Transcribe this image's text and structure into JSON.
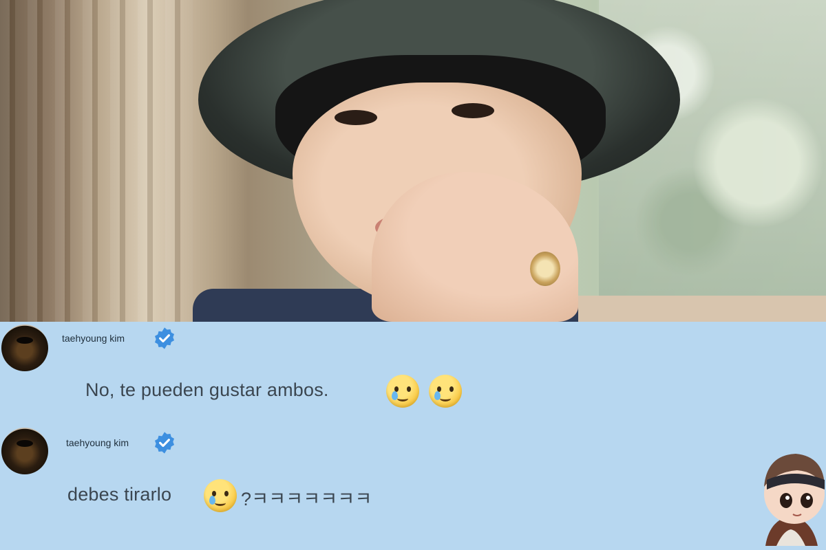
{
  "comments": [
    {
      "username": "taehyoung kim",
      "verified": true,
      "text": "No, te pueden gustar ambos.",
      "emojis": [
        "smiling-face-with-tear",
        "smiling-face-with-tear"
      ],
      "suffix": ""
    },
    {
      "username": "taehyoung kim",
      "verified": true,
      "text": "debes tirarlo",
      "emojis": [
        "smiling-face-with-tear"
      ],
      "suffix": "?ㅋㅋㅋㅋㅋㅋㅋ"
    }
  ],
  "colors": {
    "chat_background": "#b7d7f0",
    "verified_badge": "#3d8fe0",
    "text": "#3b4650"
  }
}
